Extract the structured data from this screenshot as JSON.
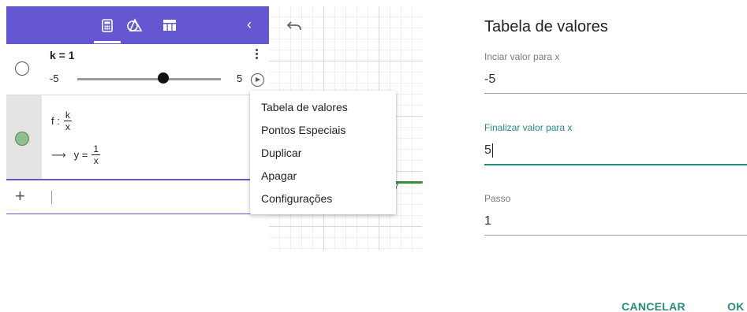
{
  "algebra": {
    "toolbar_back": "‹",
    "slider_row": {
      "expression": "k = 1",
      "min": "-5",
      "max": "5",
      "value": 1
    },
    "function_row": {
      "prefix": "f :",
      "def_num": "k",
      "def_den": "x",
      "arrow": "⟶",
      "output_lhs": "y =",
      "out_num": "1",
      "out_den": "x"
    },
    "input_row": {
      "plus": "+"
    }
  },
  "graphics": {
    "curve_label": "7",
    "curve_color": "#3c8c3c"
  },
  "context_menu": {
    "items": [
      "Tabela de valores",
      "Pontos Especiais",
      "Duplicar",
      "Apagar",
      "Configurações"
    ]
  },
  "dialog": {
    "title": "Tabela de valores",
    "start": {
      "label": "Inciar valor para x",
      "value": "-5"
    },
    "end": {
      "label": "Finalizar valor para x",
      "value": "5"
    },
    "step": {
      "label": "Passo",
      "value": "1"
    },
    "cancel": "CANCELAR",
    "ok": "OK"
  },
  "colors": {
    "toolbar": "#6557d2",
    "accent": "#2a8b7d",
    "marble_fill": "#8fbf8f"
  },
  "icons": [
    "calculator-icon",
    "geometry-tools-icon",
    "table-icon",
    "back-chevron-icon",
    "undo-icon",
    "kebab-menu-icon",
    "play-icon",
    "add-icon"
  ]
}
